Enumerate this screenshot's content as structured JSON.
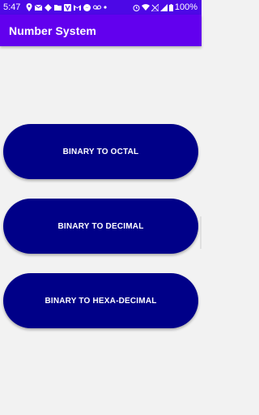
{
  "status_bar": {
    "time": "5:47",
    "battery": "100%",
    "left_icons": [
      "location-icon",
      "email-icon",
      "notification-icon",
      "folder-icon",
      "v-app-icon",
      "gmail-icon",
      "messenger-icon",
      "voicemail-icon",
      "dot-icon"
    ],
    "right_icons": [
      "alarm-icon",
      "wifi-icon",
      "no-signal-icon",
      "signal-icon",
      "battery-icon"
    ]
  },
  "app_bar": {
    "title": "Number System"
  },
  "buttons": {
    "binary_to_octal": "BINARY TO OCTAL",
    "binary_to_decimal": "BINARY TO DECIMAL",
    "binary_to_hexa_decimal": "BINARY TO HEXA-DECIMAL"
  },
  "colors": {
    "status_bar": "#4c08e6",
    "app_bar": "#6200ee",
    "button": "#000088",
    "background": "#f2f2f2"
  }
}
